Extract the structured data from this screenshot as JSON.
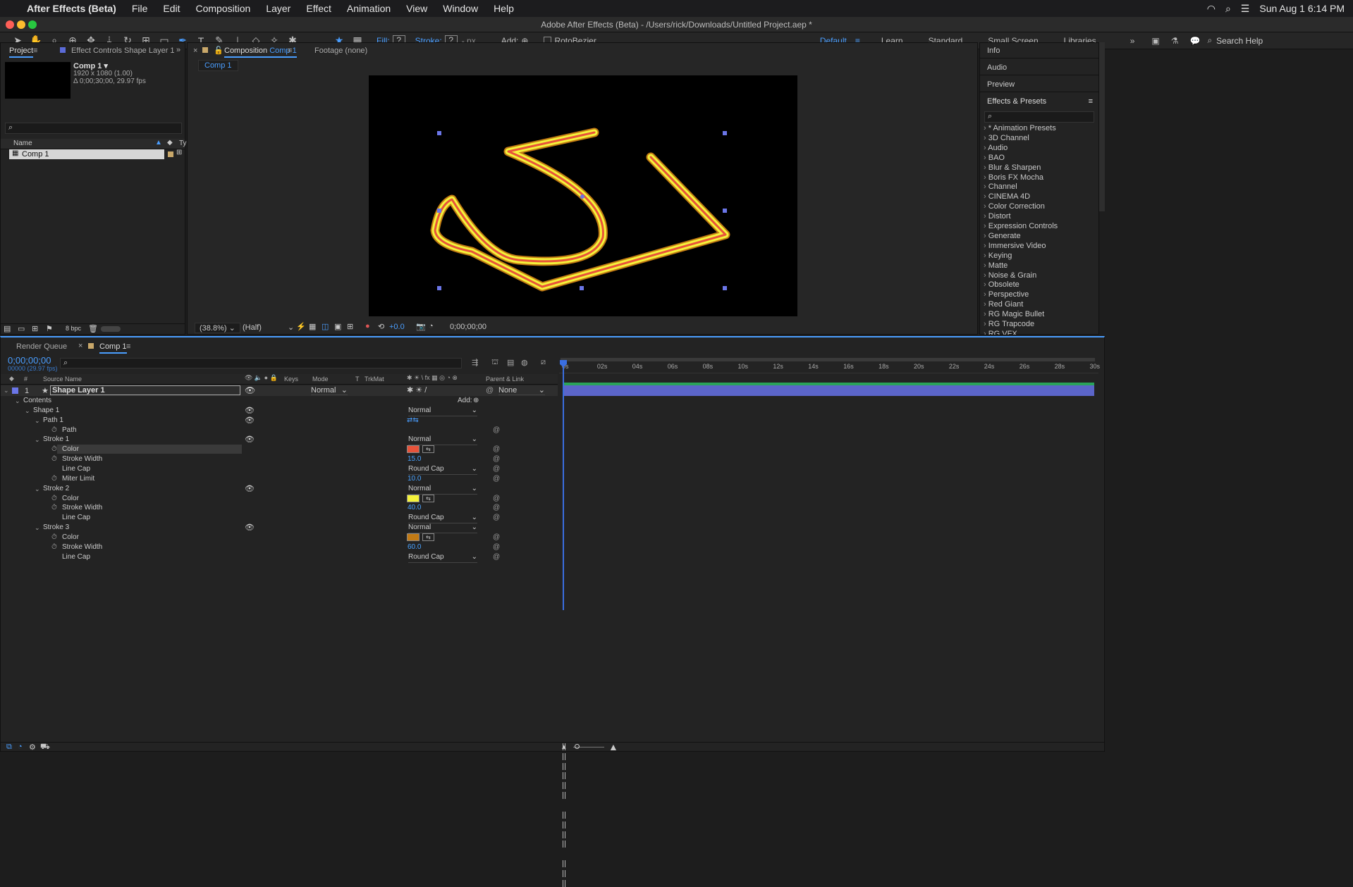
{
  "menubar": {
    "app": "After Effects (Beta)",
    "menus": [
      "File",
      "Edit",
      "Composition",
      "Layer",
      "Effect",
      "Animation",
      "View",
      "Window",
      "Help"
    ],
    "clock": "Sun Aug 1  6:14 PM"
  },
  "window": {
    "title": "Adobe After Effects (Beta) - /Users/rick/Downloads/Untitled Project.aep *"
  },
  "toolbar": {
    "fill_label": "Fill:",
    "fill_value": "?",
    "stroke_label": "Stroke:",
    "stroke_value": "?",
    "px": "- px",
    "add_label": "Add:",
    "rotobezier": "RotoBezier",
    "workspaces": [
      "Default",
      "Learn",
      "Standard",
      "Small Screen",
      "Libraries"
    ],
    "search_placeholder": "Search Help"
  },
  "project": {
    "tab": "Project",
    "effect_controls": "Effect Controls Shape Layer 1",
    "comp_name": "Comp 1 ▾",
    "comp_info1": "1920 x 1080 (1.00)",
    "comp_info2": "Δ 0;00;30;00, 29.97 fps",
    "col_name": "Name",
    "col_type": "Ty",
    "item": "Comp 1",
    "bpc": "8 bpc"
  },
  "composition": {
    "tab_prefix": "Composition",
    "tab_name": "Comp 1",
    "footage": "Footage (none)",
    "breadcrumb": "Comp 1",
    "zoom": "(38.8%)",
    "resolution": "(Half)",
    "exposure": "+0.0",
    "timecode": "0;00;00;00"
  },
  "right_panels": {
    "info": "Info",
    "audio": "Audio",
    "preview": "Preview",
    "effects": "Effects & Presets",
    "effects_list": [
      "* Animation Presets",
      "3D Channel",
      "Audio",
      "BAO",
      "Blur & Sharpen",
      "Boris FX Mocha",
      "Channel",
      "CINEMA 4D",
      "Color Correction",
      "Distort",
      "Expression Controls",
      "Generate",
      "Immersive Video",
      "Keying",
      "Matte",
      "Noise & Grain",
      "Obsolete",
      "Perspective",
      "Red Giant",
      "RG Magic Bullet",
      "RG Trapcode",
      "RG VFX"
    ]
  },
  "timeline": {
    "render_queue": "Render Queue",
    "comp_tab": "Comp 1",
    "timecode": "0;00;00;00",
    "fps": "00000 (29.97 fps)",
    "col_num": "#",
    "col_source": "Source Name",
    "col_keys": "Keys",
    "col_mode": "Mode",
    "col_t": "T",
    "col_trkmat": "TrkMat",
    "col_parent": "Parent & Link",
    "ruler": [
      "0s",
      "02s",
      "04s",
      "06s",
      "08s",
      "10s",
      "12s",
      "14s",
      "16s",
      "18s",
      "20s",
      "22s",
      "24s",
      "26s",
      "28s",
      "30s"
    ],
    "layer": {
      "num": "1",
      "name": "Shape Layer 1",
      "mode": "Normal",
      "parent": "None"
    },
    "contents": "Contents",
    "add": "Add:",
    "shape1": "Shape 1",
    "path1": "Path 1",
    "path": "Path",
    "stroke1": {
      "name": "Stroke 1",
      "mode": "Normal",
      "color_label": "Color",
      "color": "#e8533a",
      "width_label": "Stroke Width",
      "width": "15.0",
      "linecap_label": "Line Cap",
      "linecap": "Round Cap",
      "miter_label": "Miter Limit",
      "miter": "10.0"
    },
    "stroke2": {
      "name": "Stroke 2",
      "mode": "Normal",
      "color_label": "Color",
      "color": "#f4f23a",
      "width_label": "Stroke Width",
      "width": "40.0",
      "linecap_label": "Line Cap",
      "linecap": "Round Cap"
    },
    "stroke3": {
      "name": "Stroke 3",
      "mode": "Normal",
      "color_label": "Color",
      "color": "#c27a14",
      "width_label": "Stroke Width",
      "width": "60.0",
      "linecap_label": "Line Cap",
      "linecap": "Round Cap"
    },
    "shape_mode": "Normal"
  }
}
